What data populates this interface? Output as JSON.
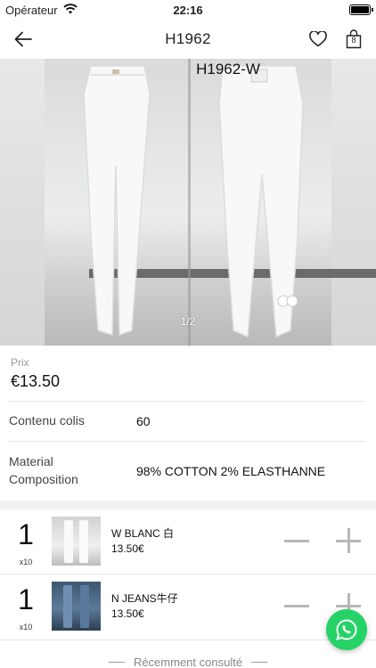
{
  "status_bar": {
    "carrier": "Opérateur",
    "time": "22:16",
    "battery_level": 1.0
  },
  "nav": {
    "title": "H1962",
    "cart_count": "8",
    "icons": {
      "back": "arrow-left-icon",
      "favorite": "heart-icon",
      "cart": "shopping-bag-icon"
    }
  },
  "carousel": {
    "image_label": "H1962-W",
    "counter": "1/2"
  },
  "product": {
    "price_label": "Prix",
    "price": "€13.50",
    "specs": [
      {
        "key": "Contenu colis",
        "value": "60"
      },
      {
        "key": "Material Composition",
        "value": "98% COTTON 2% ELASTHANNE"
      }
    ]
  },
  "variants": [
    {
      "qty": "1",
      "unit": "x10",
      "name": "W BLANC 白",
      "price": "13.50€",
      "thumb_color": "#e4e4e4"
    },
    {
      "qty": "1",
      "unit": "x10",
      "name": "N JEANS牛仔",
      "price": "13.50€",
      "thumb_color": "#4c6886"
    }
  ],
  "recent": {
    "label": "Récemment consulté"
  },
  "fab": {
    "icon": "whatsapp-icon",
    "color": "#25d366"
  }
}
